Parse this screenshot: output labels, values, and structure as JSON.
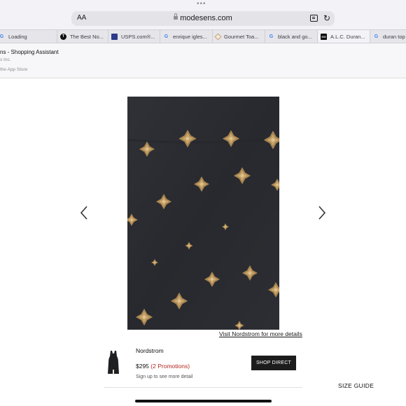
{
  "browser": {
    "text_size_button": "AA",
    "url": "modesens.com",
    "icons": [
      "lock-icon",
      "reader-icon",
      "reload-icon"
    ]
  },
  "tabs": [
    {
      "label": "Loading",
      "icon": "google-icon"
    },
    {
      "label": "The Best No...",
      "icon": "nyt-icon"
    },
    {
      "label": "USPS.com®...",
      "icon": "usps-icon"
    },
    {
      "label": "enrique igles...",
      "icon": "google-icon"
    },
    {
      "label": "Gourmet Toa...",
      "icon": "diamond-icon"
    },
    {
      "label": "black and go...",
      "icon": "google-icon"
    },
    {
      "label": "A.L.C. Duran...",
      "icon": "alc-icon"
    },
    {
      "label": "duran top",
      "icon": "google-icon"
    }
  ],
  "app_banner": {
    "title": "ns - Shopping Assistant",
    "developer": "s Inc.",
    "store_text": "the App Store"
  },
  "product": {
    "image_alt": "black fabric with gold metallic flocked pattern",
    "visit_link": "Visit Nordstrom for more details"
  },
  "retailer": {
    "name": "Nordstrom",
    "price": "$295",
    "promotions": "(2 Promotions)",
    "signup_text": "Sign up to see more detail",
    "shop_button": "SHOP DIRECT"
  },
  "size_guide": "SIZE GUIDE",
  "colors": {
    "fabric": "#2b2d32",
    "gold": "#b8965a",
    "promo": "#b3261e",
    "button": "#1c1c1c"
  }
}
